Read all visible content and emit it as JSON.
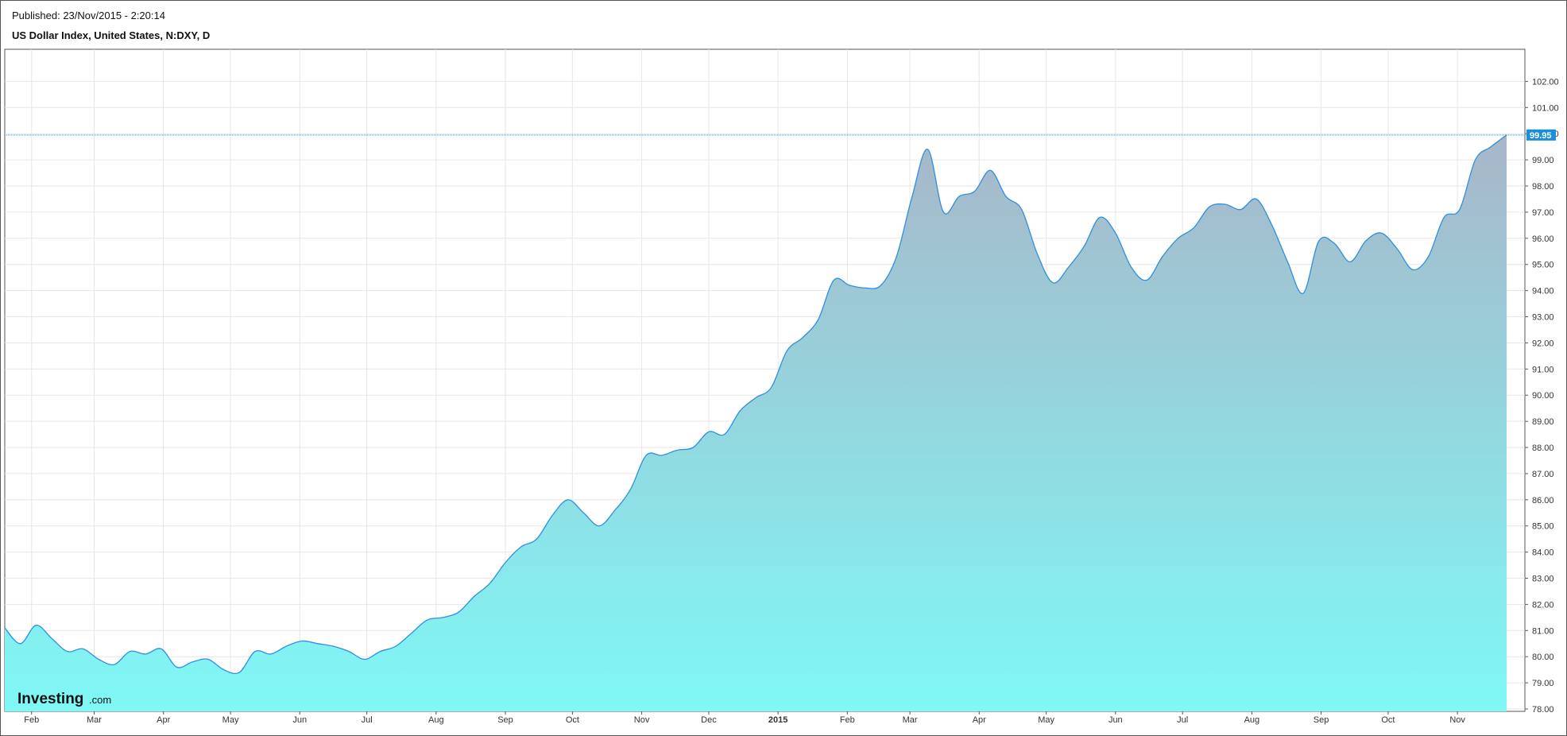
{
  "header": {
    "published": "Published: 23/Nov/2015 - 2:20:14",
    "title": "US Dollar Index, United States, N:DXY, D"
  },
  "branding": {
    "name": "Investing",
    "suffix": ".com"
  },
  "colors": {
    "line": "#2f8fdf",
    "fill_top": "#a8b6c8",
    "fill_bottom": "#7ff8f6",
    "grid": "#e6e6e6",
    "last_price_badge": "#1a8fe0"
  },
  "chart_data": {
    "type": "area",
    "title": "US Dollar Index, United States, N:DXY, D",
    "xlabel": "",
    "ylabel": "",
    "ylim": [
      77.8,
      102.5
    ],
    "y_ticks": [
      "78.00",
      "79.00",
      "80.00",
      "81.00",
      "82.00",
      "83.00",
      "84.00",
      "85.00",
      "86.00",
      "87.00",
      "88.00",
      "89.00",
      "90.00",
      "91.00",
      "92.00",
      "93.00",
      "94.00",
      "95.00",
      "96.00",
      "97.00",
      "98.00",
      "99.00",
      "100.00",
      "101.00",
      "102.00"
    ],
    "x_ticks": [
      "Feb",
      "Mar",
      "Apr",
      "May",
      "Jun",
      "Jul",
      "Aug",
      "Sep",
      "Oct",
      "Nov",
      "Dec",
      "2015",
      "Feb",
      "Mar",
      "Apr",
      "May",
      "Jun",
      "Jul",
      "Aug",
      "Sep",
      "Oct",
      "Nov"
    ],
    "last_value": "99.95",
    "grid": true,
    "series": [
      {
        "x": [
          "2014-01-20",
          "2014-01-27",
          "2014-02-03",
          "2014-02-10",
          "2014-02-17",
          "2014-02-24",
          "2014-03-03",
          "2014-03-10",
          "2014-03-17",
          "2014-03-24",
          "2014-03-31",
          "2014-04-07",
          "2014-04-14",
          "2014-04-21",
          "2014-04-28",
          "2014-05-05",
          "2014-05-12",
          "2014-05-19",
          "2014-05-26",
          "2014-06-02",
          "2014-06-09",
          "2014-06-16",
          "2014-06-23",
          "2014-06-30",
          "2014-07-07",
          "2014-07-14",
          "2014-07-21",
          "2014-07-28",
          "2014-08-04",
          "2014-08-11",
          "2014-08-18",
          "2014-08-25",
          "2014-09-01",
          "2014-09-08",
          "2014-09-15",
          "2014-09-22",
          "2014-09-29",
          "2014-10-06",
          "2014-10-13",
          "2014-10-20",
          "2014-10-27",
          "2014-11-03",
          "2014-11-10",
          "2014-11-17",
          "2014-11-24",
          "2014-12-01",
          "2014-12-08",
          "2014-12-15",
          "2014-12-22",
          "2014-12-29",
          "2015-01-05",
          "2015-01-12",
          "2015-01-19",
          "2015-01-26",
          "2015-02-02",
          "2015-02-09",
          "2015-02-16",
          "2015-02-23",
          "2015-03-02",
          "2015-03-09",
          "2015-03-16",
          "2015-03-23",
          "2015-03-30",
          "2015-04-06",
          "2015-04-13",
          "2015-04-20",
          "2015-04-27",
          "2015-05-04",
          "2015-05-11",
          "2015-05-18",
          "2015-05-25",
          "2015-06-01",
          "2015-06-08",
          "2015-06-15",
          "2015-06-22",
          "2015-06-29",
          "2015-07-06",
          "2015-07-13",
          "2015-07-20",
          "2015-07-27",
          "2015-08-03",
          "2015-08-10",
          "2015-08-17",
          "2015-08-24",
          "2015-08-31",
          "2015-09-07",
          "2015-09-14",
          "2015-09-21",
          "2015-09-28",
          "2015-10-05",
          "2015-10-12",
          "2015-10-19",
          "2015-10-26",
          "2015-11-02",
          "2015-11-09",
          "2015-11-16",
          "2015-11-23"
        ],
        "values": [
          81.1,
          80.5,
          81.2,
          80.7,
          80.2,
          80.3,
          79.9,
          79.7,
          80.2,
          80.1,
          80.3,
          79.6,
          79.8,
          79.9,
          79.5,
          79.4,
          80.2,
          80.1,
          80.4,
          80.6,
          80.5,
          80.4,
          80.2,
          79.9,
          80.2,
          80.4,
          80.9,
          81.4,
          81.5,
          81.7,
          82.3,
          82.8,
          83.6,
          84.2,
          84.5,
          85.4,
          86.0,
          85.5,
          85.0,
          85.6,
          86.4,
          87.7,
          87.7,
          87.9,
          88.0,
          88.6,
          88.5,
          89.4,
          89.9,
          90.3,
          91.7,
          92.2,
          92.9,
          94.4,
          94.2,
          94.1,
          94.2,
          95.3,
          97.6,
          99.4,
          97.0,
          97.6,
          97.8,
          98.6,
          97.6,
          97.1,
          95.4,
          94.3,
          94.9,
          95.7,
          96.8,
          96.2,
          94.9,
          94.4,
          95.3,
          96.0,
          96.4,
          97.2,
          97.3,
          97.1,
          97.5,
          96.5,
          95.1,
          93.9,
          95.9,
          95.8,
          95.1,
          95.9,
          96.2,
          95.6,
          94.8,
          95.3,
          96.8,
          97.1,
          99.0,
          99.5,
          99.95
        ]
      }
    ]
  }
}
